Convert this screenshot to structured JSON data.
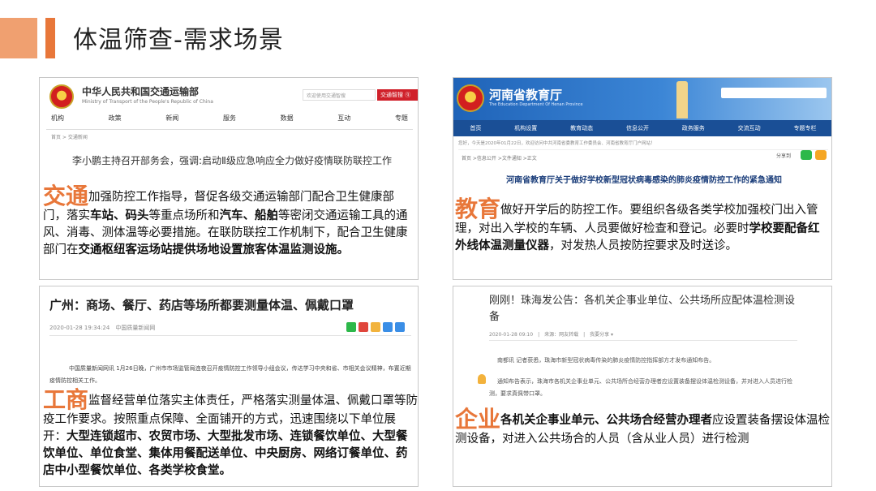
{
  "slide": {
    "title": "体温筛查-需求场景"
  },
  "transport": {
    "site_name": "中华人民共和国交通运输部",
    "site_name_en": "Ministry of Transport of the People's Republic of China",
    "search_placeholder": "欢迎使用交通智搜",
    "smart_search": "交通智搜 ⓠ",
    "nav": [
      "机构",
      "政策",
      "新闻",
      "服务",
      "数据",
      "互动",
      "专题"
    ],
    "breadcrumb": "首页 > 交通新闻",
    "headline": "李小鹏主持召开部务会，强调:启动Ⅱ级应急响应全力做好疫情联防联控工作",
    "keyword": "交通",
    "body": [
      {
        "t": "加强防控工作指导，督促各级交通运输部门配合卫生健康部门，落实",
        "b": false
      },
      {
        "t": "车站、码头",
        "b": true
      },
      {
        "t": "等重点场所和",
        "b": false
      },
      {
        "t": "汽车、船舶",
        "b": true
      },
      {
        "t": "等密闭交通运输工具的通风、消毒、测体温等必要措施。在联防联控工作机制下，配合卫生健康部门在",
        "b": false
      },
      {
        "t": "交通枢纽客运场站提供场地设置旅客体温监测设施。",
        "b": true
      }
    ]
  },
  "education": {
    "site_name": "河南省教育厅",
    "site_name_en": "The Education Department Of Henan Province",
    "nav": [
      "首页",
      "机构设置",
      "教育动态",
      "信息公开",
      "政务服务",
      "交流互动",
      "专题专栏"
    ],
    "info_bar": "您好，今天是2020年01月22日，欢迎访问中共河南省委教育工作委员会、河南省教育厅门户网站！",
    "breadcrumb": "首页 >信息公开 >文件通知 >正文",
    "share": "分享到",
    "headline": "河南省教育厅关于做好学校新型冠状病毒感染的肺炎疫情防控工作的紧急通知",
    "keyword": "教育",
    "body": [
      {
        "t": "做好开学后的防控工作。要组织各级各类学校加强校门出入管理，对出入学校的车辆、人员要做好检查和登记。必要时",
        "b": false
      },
      {
        "t": "学校要配备红外线体温测量仪器",
        "b": true
      },
      {
        "t": "，对发热人员按防控要求及时送诊。",
        "b": false
      }
    ]
  },
  "business": {
    "headline": "广州：商场、餐厅、药店等场所都要测量体温、佩戴口罩",
    "meta": "2020-01-28 19:34:24　中国质量新闻网",
    "lead": "中国质量新闻网讯 1月26日晚，广州市市场监管局连夜召开疫情防控工作领导小组会议，传达学习中央和省、市相关会议精神，布置近期疫情防控相关工作。",
    "keyword": "工商",
    "body": [
      {
        "t": "监督经营单位落实主体责任，严格落实测量体温、佩戴口罩等防疫工作要求。按照重点保障、全面铺开的方式，迅速围绕以下单位展开：",
        "b": false
      },
      {
        "t": "大型连锁超市、农贸市场、大型批发市场、连锁餐饮单位、大型餐饮单位、单位食堂、集体用餐配送单位、中央厨房、网络订餐单位、药店中小型餐饮单位、各类学校食堂。",
        "b": true
      }
    ]
  },
  "enterprise": {
    "headline": "刚刚！珠海发公告：各机关企事业单位、公共场所应配体温检测设备",
    "meta": "2020-01-28 09:10　|　来源：网友转载　|　我要分享 ▾",
    "para1": "南都讯 记者获悉，珠海市新型冠状病毒传染的肺炎疫情防控指挥部方才发布通知布告。",
    "para2": "通知布告表示，珠海市各机关企事业单元、公共场所合经营办理者应设置装备摆设体温检测设备，并对进入人员进行检测，要求真佩带口罩。",
    "keyword": "企业",
    "body": [
      {
        "t": "各机关企事业单元、公共场合经营办理者",
        "b": true
      },
      {
        "t": "应设置装备摆设体温检测设备，对进入公共场合的人员（含从业人员）进行检测",
        "b": false
      }
    ]
  },
  "colors": {
    "accent": "#e8773a",
    "accent_light": "#f0a070",
    "edu_blue": "#1f63b8",
    "gov_red": "#d0202a"
  }
}
